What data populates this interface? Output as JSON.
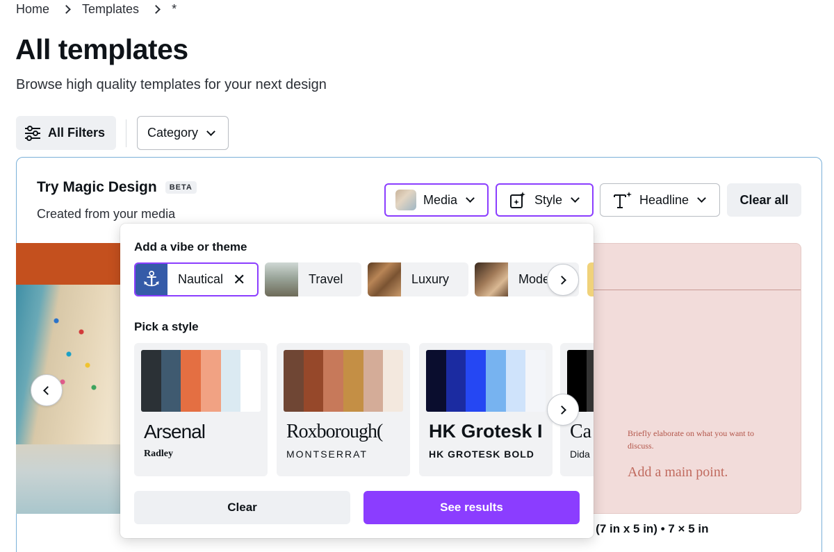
{
  "breadcrumb": {
    "items": [
      "Home",
      "Templates",
      "*"
    ]
  },
  "page": {
    "title": "All templates",
    "subtitle": "Browse high quality templates for your next design"
  },
  "filters": {
    "all_filters_label": "All Filters",
    "category_label": "Category"
  },
  "magic": {
    "title": "Try Magic Design",
    "badge": "BETA",
    "subtitle": "Created from your media",
    "media_label": "Media",
    "style_label": "Style",
    "headline_label": "Headline",
    "clear_all_label": "Clear all"
  },
  "popover": {
    "vibe_title": "Add a vibe or theme",
    "vibes": [
      {
        "label": "Nautical",
        "selected": true,
        "icon": "anchor-icon"
      },
      {
        "label": "Travel",
        "selected": false
      },
      {
        "label": "Luxury",
        "selected": false
      },
      {
        "label": "Mode",
        "selected": false
      }
    ],
    "style_title": "Pick a style",
    "styles": [
      {
        "name": "Arsenal",
        "sub": "Radley",
        "colors": [
          "#2b3136",
          "#3f5a70",
          "#e46f42",
          "#f1a283",
          "#dbeaf2",
          "#ffffff"
        ]
      },
      {
        "name": "Roxborough(",
        "sub": "MONTSERRAT",
        "colors": [
          "#6f4634",
          "#96482a",
          "#c7795a",
          "#c48f45",
          "#d4ac98",
          "#f3e8de"
        ]
      },
      {
        "name": "HK Grotesk I",
        "sub": "HK GROTESK BOLD",
        "colors": [
          "#0a0d2e",
          "#1b2ba1",
          "#2547f3",
          "#77b3f0",
          "#cfe3fb",
          "#f3f5f9"
        ]
      },
      {
        "name": "Ca",
        "sub": "Dida",
        "colors": [
          "#000000",
          "#333333"
        ]
      }
    ],
    "clear_label": "Clear",
    "see_results_label": "See results"
  },
  "preview": {
    "small_text": "Briefly elaborate on what you want to discuss.",
    "main_point": "Add a main point.",
    "caption": "e (7 in x 5 in) • 7 × 5 in"
  },
  "colors": {
    "accent": "#8b3dff",
    "anchor_bg": "#355ba8",
    "panel_border": "#7ab0d8"
  }
}
